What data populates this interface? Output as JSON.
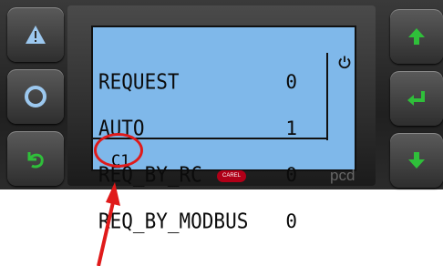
{
  "display": {
    "rows": [
      {
        "label": "REQUEST",
        "value": "0"
      },
      {
        "label": "AUTO",
        "value": "1"
      },
      {
        "label": "REQ_BY_RC",
        "value": "0"
      },
      {
        "label": "REQ_BY_MODBUS",
        "value": "0"
      }
    ],
    "index_label": "C1",
    "power_icon": "power-icon",
    "background_color": "#7fb8ea"
  },
  "branding": {
    "logo_text": "CAREL",
    "model_mark": "pcd"
  },
  "keys": {
    "alarm": "alarm-triangle-icon",
    "prg": "prg-circle-icon",
    "esc": "esc-return-icon",
    "up": "arrow-up-icon",
    "enter": "enter-icon",
    "down": "arrow-down-icon"
  },
  "annotation": {
    "highlight_color": "#e01a1a"
  }
}
